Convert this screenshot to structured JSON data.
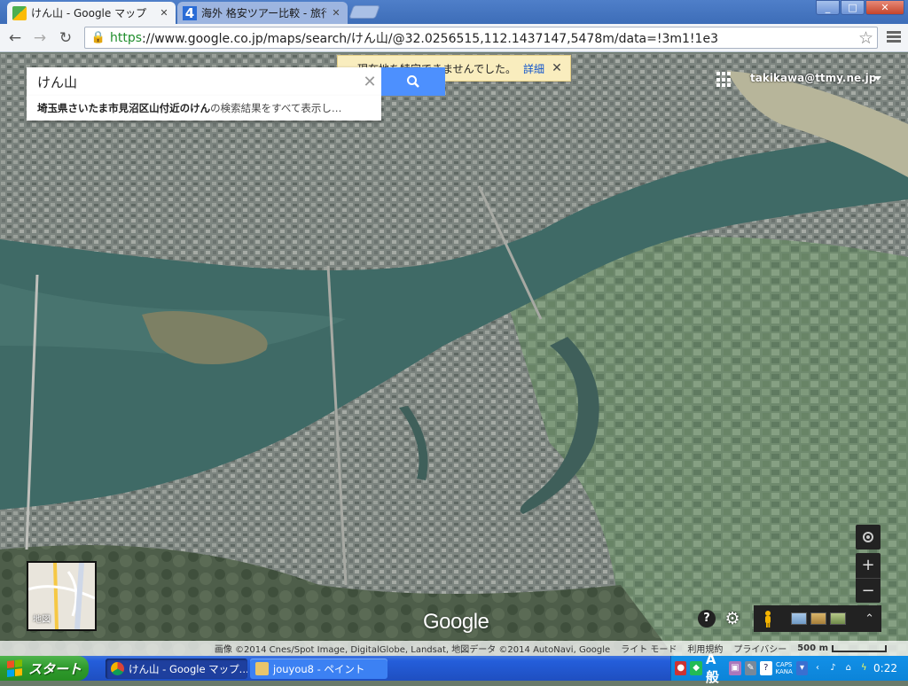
{
  "browser": {
    "tabs": [
      {
        "title": "けん山 - Google マップ",
        "active": true
      },
      {
        "title": "海外 格安ツアー比較 - 旅行",
        "active": false
      }
    ],
    "url_https": "https",
    "url_rest": "://www.google.co.jp/maps/search/けん山/@32.0256515,112.1437147,5478m/data=!3m1!1e3",
    "window_buttons": {
      "minimize": "_",
      "maximize": "□",
      "close": "✕"
    }
  },
  "map": {
    "search_value": "けん山",
    "suggestion_bold": "埼玉県さいたま市見沼区山付近のけん",
    "suggestion_rest": "の検索結果をすべて表示し…",
    "geo_alert_text": "現在地を特定できませんでした。",
    "geo_alert_link": "詳細",
    "account": "takikawa@ttmy.ne.jp",
    "minimap_label": "地図",
    "logo_text": "Google",
    "footer": {
      "attribution": "画像 ©2014 Cnes/Spot Image, DigitalGlobe, Landsat, 地図データ ©2014 AutoNavi, Google",
      "lite_mode": "ライト モード",
      "terms": "利用規約",
      "privacy": "プライバシー",
      "scale": "500 m"
    },
    "colors": {
      "search_button": "#4d90fe",
      "alert_bg": "#f9edbe",
      "link": "#1155cc"
    }
  },
  "taskbar": {
    "start_label": "スタート",
    "items": [
      {
        "label": "けん山 - Google マップ...",
        "active": true
      },
      {
        "label": "jouyou8 - ペイント",
        "active": false
      }
    ],
    "ime_mode": "A般",
    "caps": "CAPS",
    "kana": "KANA",
    "clock": "0:22"
  }
}
